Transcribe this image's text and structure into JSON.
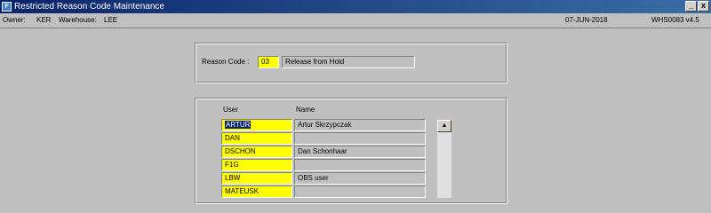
{
  "window": {
    "title": "Restricted Reason Code Maintenance",
    "icon_name": "app-form-icon",
    "minimize_glyph": "_",
    "close_glyph": "x"
  },
  "info": {
    "owner_label": "Owner:",
    "owner_value": "KER",
    "warehouse_label": "Warehouse:",
    "warehouse_value": "LEE",
    "date": "07-JUN-2018",
    "app_version": "WHS0083  v4.5"
  },
  "reason": {
    "label": "Reason Code :",
    "code": "03",
    "description": "Release from Hold"
  },
  "users": {
    "header_user": "User",
    "header_name": "Name",
    "rows": [
      {
        "user": "ARTUR",
        "name": "Artur Skrzypczak"
      },
      {
        "user": "DAN",
        "name": ""
      },
      {
        "user": "DSCHON",
        "name": "Dan Schonhaar"
      },
      {
        "user": "F1G",
        "name": ""
      },
      {
        "user": "LBW",
        "name": "OBS user"
      },
      {
        "user": "MATEUSK",
        "name": ""
      }
    ]
  },
  "scrollbar": {
    "up_glyph": "▲"
  },
  "colors": {
    "title_start": "#0a246a",
    "title_end": "#3a6ea5",
    "input_bg": "#ffff00",
    "window_bg": "#c0c0c0"
  }
}
